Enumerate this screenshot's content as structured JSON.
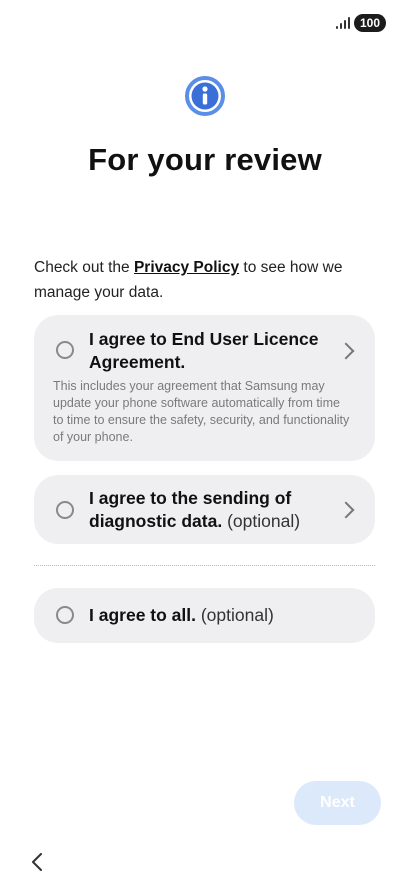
{
  "status_bar": {
    "battery": "100"
  },
  "header": {
    "title": "For your review"
  },
  "intro": {
    "prefix": "Check out the ",
    "link": "Privacy Policy",
    "suffix": " to see how we manage your data."
  },
  "agreements": {
    "eula": {
      "title": "I agree to End User Licence Agreement.",
      "description": "This includes your agreement that Samsung may update your phone software automatically from time to time to ensure the safety, security, and functionality of your phone."
    },
    "diagnostic": {
      "title": "I agree to the sending of diagnostic data.",
      "optional": " (optional)"
    },
    "all": {
      "title": "I agree to all.",
      "optional": " (optional)"
    }
  },
  "footer": {
    "next_label": "Next"
  },
  "colors": {
    "accent": "#5b8ee6",
    "card_bg": "#efeff1",
    "next_disabled_bg": "#dce9fb"
  },
  "icons": [
    "signal-icon",
    "info-icon",
    "chevron-right-icon",
    "back-icon"
  ]
}
